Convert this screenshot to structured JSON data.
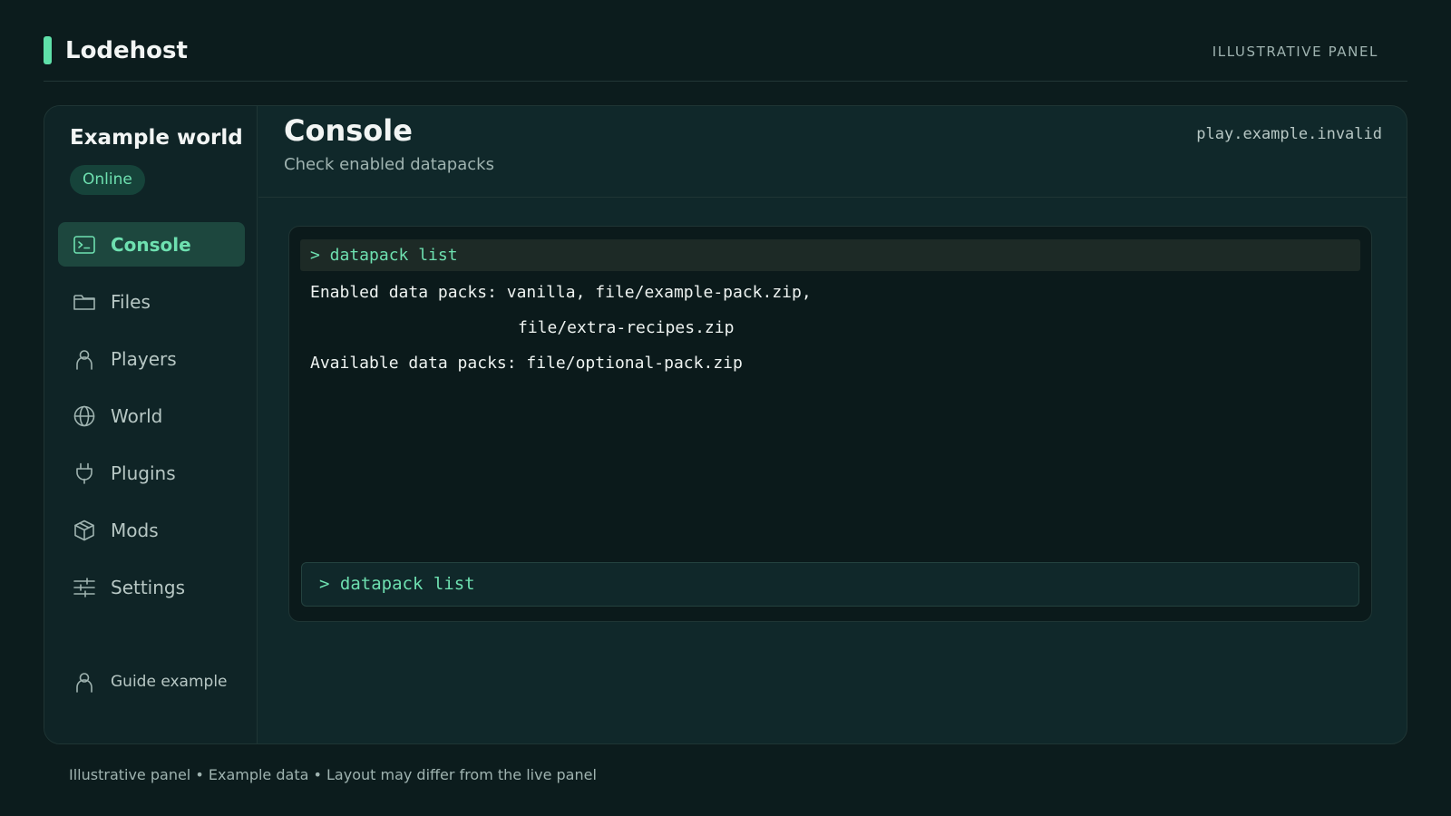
{
  "brand": {
    "name": "Lodehost",
    "tag": "ILLUSTRATIVE PANEL",
    "accent": "#5fe0a9"
  },
  "sidebar": {
    "world_name": "Example world",
    "status": "Online",
    "items": [
      {
        "label": "Console",
        "icon": "terminal-icon",
        "active": true
      },
      {
        "label": "Files",
        "icon": "folder-icon",
        "active": false
      },
      {
        "label": "Players",
        "icon": "user-icon",
        "active": false
      },
      {
        "label": "World",
        "icon": "globe-icon",
        "active": false
      },
      {
        "label": "Plugins",
        "icon": "plug-icon",
        "active": false
      },
      {
        "label": "Mods",
        "icon": "box-icon",
        "active": false
      },
      {
        "label": "Settings",
        "icon": "sliders-icon",
        "active": false
      }
    ],
    "user": {
      "label": "Guide example",
      "icon": "user-icon"
    }
  },
  "main": {
    "title": "Console",
    "subtitle": "Check enabled datapacks",
    "server_address": "play.example.invalid",
    "console": {
      "command": "> datapack list",
      "lines": [
        "Enabled data packs: vanilla, file/example-pack.zip,",
        "file/extra-recipes.zip",
        "Available data packs: file/optional-pack.zip"
      ],
      "input_value": "> datapack list"
    }
  },
  "footer": {
    "note": "Illustrative panel • Example data • Layout may differ from the live panel"
  },
  "colors": {
    "background": "#0c1c1d",
    "panel": "#10282a",
    "active_text": "#6ee0b0",
    "active_bg": "#1d473e"
  }
}
